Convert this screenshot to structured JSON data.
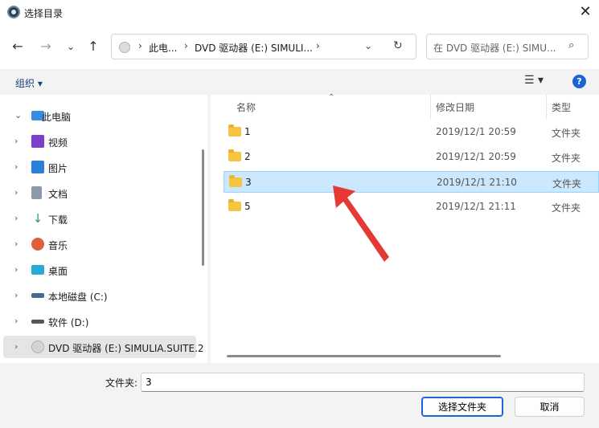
{
  "window": {
    "title": "选择目录",
    "close_glyph": "✕"
  },
  "nav": {
    "back": "←",
    "forward": "→",
    "recent": "⌄",
    "up": "↑",
    "breadcrumb": [
      "此电...",
      "DVD 驱动器 (E:) SIMULI..."
    ],
    "breadcrumb_sep": "›",
    "dropdown": "⌄",
    "refresh": "↻",
    "search_placeholder": "在 DVD 驱动器 (E:) SIMU...",
    "search_icon": "⌕"
  },
  "toolbar": {
    "organize": "组织 ▾",
    "view": "☰ ▾",
    "help": "?"
  },
  "tree": {
    "items": [
      {
        "label": "此电脑",
        "icon": "computer-icon",
        "chev": "⌄",
        "color": "#3a8ddb"
      },
      {
        "label": "视频",
        "icon": "video-icon",
        "chev": "›",
        "color": "#7b3fc8"
      },
      {
        "label": "图片",
        "icon": "pictures-icon",
        "chev": "›",
        "color": "#2b7fd6"
      },
      {
        "label": "文档",
        "icon": "documents-icon",
        "chev": "›",
        "color": "#6d7a8a"
      },
      {
        "label": "下载",
        "icon": "download-icon",
        "chev": "›",
        "color": "#1f9d6b"
      },
      {
        "label": "音乐",
        "icon": "music-icon",
        "chev": "›",
        "color": "#e0603a"
      },
      {
        "label": "桌面",
        "icon": "desktop-icon",
        "chev": "›",
        "color": "#2aa8d8"
      },
      {
        "label": "本地磁盘 (C:)",
        "icon": "drive-c-icon",
        "chev": "›",
        "color": "#4a6a8a"
      },
      {
        "label": "软件 (D:)",
        "icon": "drive-d-icon",
        "chev": "›",
        "color": "#555555"
      },
      {
        "label": "DVD 驱动器 (E:) SIMULIA.SUITE.2",
        "icon": "dvd-drive-icon",
        "chev": "›",
        "color": "#cccccc"
      }
    ]
  },
  "columns": {
    "name": "名称",
    "modified": "修改日期",
    "type": "类型"
  },
  "files": [
    {
      "name": "1",
      "date": "2019/12/1 20:59",
      "type": "文件夹"
    },
    {
      "name": "2",
      "date": "2019/12/1 20:59",
      "type": "文件夹"
    },
    {
      "name": "3",
      "date": "2019/12/1 21:10",
      "type": "文件夹"
    },
    {
      "name": "5",
      "date": "2019/12/1 21:11",
      "type": "文件夹"
    }
  ],
  "bottom": {
    "folder_label": "文件夹:",
    "folder_value": "3",
    "select_button": "选择文件夹",
    "cancel_button": "取消"
  },
  "colors": {
    "accent": "#1c63d3",
    "selection": "#cce8ff",
    "annotation_arrow": "#e53935"
  }
}
